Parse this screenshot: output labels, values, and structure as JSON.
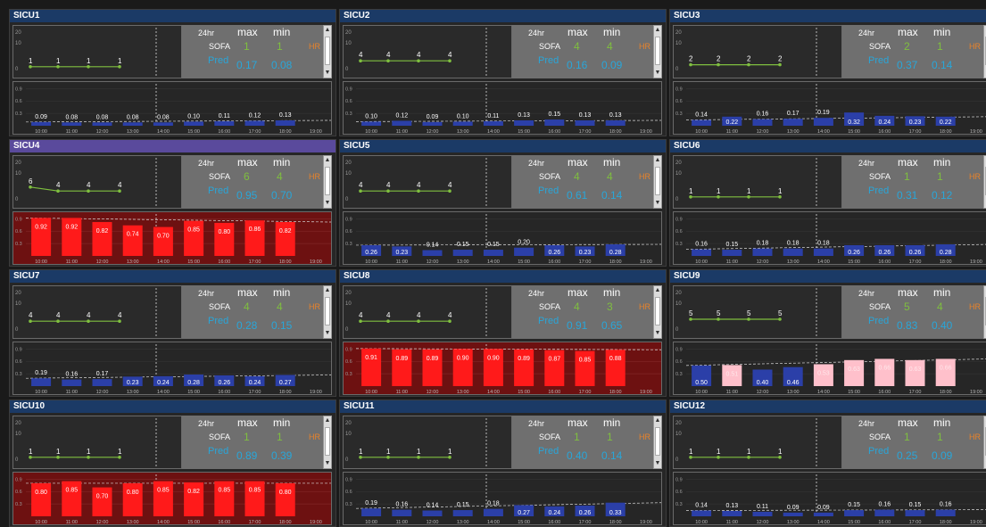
{
  "labels": {
    "hr24": "24hr",
    "max": "max",
    "min": "min",
    "sofa": "SOFA",
    "pred": "Pred",
    "hr": "HR"
  },
  "axis": {
    "top_ticks": [
      "20",
      "10",
      "0"
    ],
    "bottom_ticks": [
      "0.9",
      "0.6",
      "0.3"
    ]
  },
  "times": [
    "10:00",
    "11:00",
    "12:00",
    "13:00",
    "14:00",
    "15:00",
    "16:00",
    "17:00",
    "18:00",
    "19:00"
  ],
  "colors": {
    "header_blue": "#1b3a66",
    "header_purple": "#5a4a9c",
    "sofa_green": "#7fbf3f",
    "pred_cyan": "#29a6d9",
    "hr_orange": "#e8822a",
    "bar_blue": "#2b3fa8",
    "bar_red": "#ff1a1a",
    "bar_pink": "#ffc0cb"
  },
  "panels": [
    {
      "name": "SICU1",
      "highlight": false,
      "sofa": [
        "1",
        "1",
        "1",
        "1"
      ],
      "sofa_max": "1",
      "sofa_min": "1",
      "pred_max": "0.17",
      "pred_min": "0.08",
      "bars": [
        {
          "v": 0.09,
          "t": "0.09"
        },
        {
          "v": 0.08,
          "t": "0.08"
        },
        {
          "v": 0.08,
          "t": "0.08"
        },
        {
          "v": 0.08,
          "t": "0.08"
        },
        {
          "v": 0.08,
          "t": "0.08"
        },
        {
          "v": 0.1,
          "t": "0.10"
        },
        {
          "v": 0.11,
          "t": "0.11"
        },
        {
          "v": 0.12,
          "t": "0.12"
        },
        {
          "v": 0.13,
          "t": "0.13"
        }
      ]
    },
    {
      "name": "SICU2",
      "highlight": false,
      "sofa": [
        "4",
        "4",
        "4",
        "4"
      ],
      "sofa_max": "4",
      "sofa_min": "4",
      "pred_max": "0.16",
      "pred_min": "0.09",
      "bars": [
        {
          "v": 0.1,
          "t": "0.10"
        },
        {
          "v": 0.12,
          "t": "0.12"
        },
        {
          "v": 0.09,
          "t": "0.09"
        },
        {
          "v": 0.1,
          "t": "0.10"
        },
        {
          "v": 0.11,
          "t": "0.11"
        },
        {
          "v": 0.13,
          "t": "0.13"
        },
        {
          "v": 0.15,
          "t": "0.15"
        },
        {
          "v": 0.13,
          "t": "0.13"
        },
        {
          "v": 0.13,
          "t": "0.13"
        }
      ]
    },
    {
      "name": "SICU3",
      "highlight": false,
      "sofa": [
        "2",
        "2",
        "2",
        "2"
      ],
      "sofa_max": "2",
      "sofa_min": "1",
      "pred_max": "0.37",
      "pred_min": "0.14",
      "bars": [
        {
          "v": 0.14,
          "t": "0.14"
        },
        {
          "v": 0.22,
          "t": "0.22"
        },
        {
          "v": 0.16,
          "t": "0.16"
        },
        {
          "v": 0.17,
          "t": "0.17"
        },
        {
          "v": 0.19,
          "t": "0.19"
        },
        {
          "v": 0.32,
          "t": "0.32"
        },
        {
          "v": 0.24,
          "t": "0.24"
        },
        {
          "v": 0.23,
          "t": "0.23"
        },
        {
          "v": 0.22,
          "t": "0.22"
        }
      ]
    },
    {
      "name": "SICU4",
      "highlight": true,
      "sofa": [
        "6",
        "4",
        "4",
        "4"
      ],
      "sofa_max": "6",
      "sofa_min": "4",
      "pred_max": "0.95",
      "pred_min": "0.70",
      "bars": [
        {
          "v": 0.92,
          "t": "0.92"
        },
        {
          "v": 0.92,
          "t": "0.92"
        },
        {
          "v": 0.82,
          "t": "0.82"
        },
        {
          "v": 0.74,
          "t": "0.74"
        },
        {
          "v": 0.7,
          "t": "0.70"
        },
        {
          "v": 0.85,
          "t": "0.85"
        },
        {
          "v": 0.8,
          "t": "0.80"
        },
        {
          "v": 0.86,
          "t": "0.86"
        },
        {
          "v": 0.82,
          "t": "0.82"
        }
      ]
    },
    {
      "name": "SICU5",
      "highlight": false,
      "sofa": [
        "4",
        "4",
        "4",
        "4"
      ],
      "sofa_max": "4",
      "sofa_min": "4",
      "pred_max": "0.61",
      "pred_min": "0.14",
      "bars": [
        {
          "v": 0.26,
          "t": "0.26"
        },
        {
          "v": 0.23,
          "t": "0.23"
        },
        {
          "v": 0.14,
          "t": "0.14"
        },
        {
          "v": 0.15,
          "t": "0.15"
        },
        {
          "v": 0.15,
          "t": "0.15"
        },
        {
          "v": 0.2,
          "t": "0.20"
        },
        {
          "v": 0.26,
          "t": "0.26"
        },
        {
          "v": 0.23,
          "t": "0.23"
        },
        {
          "v": 0.28,
          "t": "0.28"
        }
      ]
    },
    {
      "name": "SICU6",
      "highlight": false,
      "sofa": [
        "1",
        "1",
        "1",
        "1"
      ],
      "sofa_max": "1",
      "sofa_min": "1",
      "pred_max": "0.31",
      "pred_min": "0.12",
      "bars": [
        {
          "v": 0.16,
          "t": "0.16"
        },
        {
          "v": 0.15,
          "t": "0.15"
        },
        {
          "v": 0.18,
          "t": "0.18"
        },
        {
          "v": 0.18,
          "t": "0.18"
        },
        {
          "v": 0.18,
          "t": "0.18"
        },
        {
          "v": 0.26,
          "t": "0.26"
        },
        {
          "v": 0.26,
          "t": "0.26"
        },
        {
          "v": 0.26,
          "t": "0.26"
        },
        {
          "v": 0.28,
          "t": "0.28"
        }
      ]
    },
    {
      "name": "SICU7",
      "highlight": false,
      "sofa": [
        "4",
        "4",
        "4",
        "4"
      ],
      "sofa_max": "4",
      "sofa_min": "4",
      "pred_max": "0.28",
      "pred_min": "0.15",
      "bars": [
        {
          "v": 0.19,
          "t": "0.19"
        },
        {
          "v": 0.16,
          "t": "0.16"
        },
        {
          "v": 0.17,
          "t": "0.17"
        },
        {
          "v": 0.23,
          "t": "0.23"
        },
        {
          "v": 0.24,
          "t": "0.24"
        },
        {
          "v": 0.28,
          "t": "0.28"
        },
        {
          "v": 0.26,
          "t": "0.26"
        },
        {
          "v": 0.24,
          "t": "0.24"
        },
        {
          "v": 0.27,
          "t": "0.27"
        }
      ]
    },
    {
      "name": "SICU8",
      "highlight": false,
      "sofa": [
        "4",
        "4",
        "4",
        "4"
      ],
      "sofa_max": "4",
      "sofa_min": "3",
      "pred_max": "0.91",
      "pred_min": "0.65",
      "bars": [
        {
          "v": 0.91,
          "t": "0.91"
        },
        {
          "v": 0.89,
          "t": "0.89"
        },
        {
          "v": 0.89,
          "t": "0.89"
        },
        {
          "v": 0.9,
          "t": "0.90"
        },
        {
          "v": 0.9,
          "t": "0.90"
        },
        {
          "v": 0.89,
          "t": "0.89"
        },
        {
          "v": 0.87,
          "t": "0.87"
        },
        {
          "v": 0.85,
          "t": "0.85"
        },
        {
          "v": 0.88,
          "t": "0.88"
        }
      ]
    },
    {
      "name": "SICU9",
      "highlight": false,
      "sofa": [
        "5",
        "5",
        "5",
        "5"
      ],
      "sofa_max": "5",
      "sofa_min": "4",
      "pred_max": "0.83",
      "pred_min": "0.40",
      "bars": [
        {
          "v": 0.5,
          "t": "0.50"
        },
        {
          "v": 0.51,
          "t": "0.51"
        },
        {
          "v": 0.4,
          "t": "0.40"
        },
        {
          "v": 0.46,
          "t": "0.46"
        },
        {
          "v": 0.53,
          "t": "0.53"
        },
        {
          "v": 0.63,
          "t": "0.63"
        },
        {
          "v": 0.66,
          "t": "0.66"
        },
        {
          "v": 0.63,
          "t": "0.63"
        },
        {
          "v": 0.66,
          "t": "0.66"
        }
      ]
    },
    {
      "name": "SICU10",
      "highlight": false,
      "sofa": [
        "1",
        "1",
        "1",
        "1"
      ],
      "sofa_max": "1",
      "sofa_min": "1",
      "pred_max": "0.89",
      "pred_min": "0.39",
      "bars": [
        {
          "v": 0.8,
          "t": "0.80"
        },
        {
          "v": 0.85,
          "t": "0.85"
        },
        {
          "v": 0.7,
          "t": "0.70"
        },
        {
          "v": 0.8,
          "t": "0.80"
        },
        {
          "v": 0.85,
          "t": "0.85"
        },
        {
          "v": 0.82,
          "t": "0.82"
        },
        {
          "v": 0.85,
          "t": "0.85"
        },
        {
          "v": 0.85,
          "t": "0.85"
        },
        {
          "v": 0.8,
          "t": "0.80"
        }
      ]
    },
    {
      "name": "SICU11",
      "highlight": false,
      "sofa": [
        "1",
        "1",
        "1",
        "1"
      ],
      "sofa_max": "1",
      "sofa_min": "1",
      "pred_max": "0.40",
      "pred_min": "0.14",
      "bars": [
        {
          "v": 0.19,
          "t": "0.19"
        },
        {
          "v": 0.16,
          "t": "0.16"
        },
        {
          "v": 0.14,
          "t": "0.14"
        },
        {
          "v": 0.15,
          "t": "0.15"
        },
        {
          "v": 0.18,
          "t": "0.18"
        },
        {
          "v": 0.27,
          "t": "0.27"
        },
        {
          "v": 0.24,
          "t": "0.24"
        },
        {
          "v": 0.26,
          "t": "0.26"
        },
        {
          "v": 0.33,
          "t": "0.33"
        }
      ]
    },
    {
      "name": "SICU12",
      "highlight": false,
      "sofa": [
        "1",
        "1",
        "1",
        "1"
      ],
      "sofa_max": "1",
      "sofa_min": "1",
      "pred_max": "0.25",
      "pred_min": "0.09",
      "bars": [
        {
          "v": 0.14,
          "t": "0.14"
        },
        {
          "v": 0.13,
          "t": "0.13"
        },
        {
          "v": 0.11,
          "t": "0.11"
        },
        {
          "v": 0.09,
          "t": "0.09"
        },
        {
          "v": 0.09,
          "t": "0.09"
        },
        {
          "v": 0.15,
          "t": "0.15"
        },
        {
          "v": 0.16,
          "t": "0.16"
        },
        {
          "v": 0.15,
          "t": "0.15"
        },
        {
          "v": 0.16,
          "t": "0.16"
        }
      ]
    }
  ]
}
